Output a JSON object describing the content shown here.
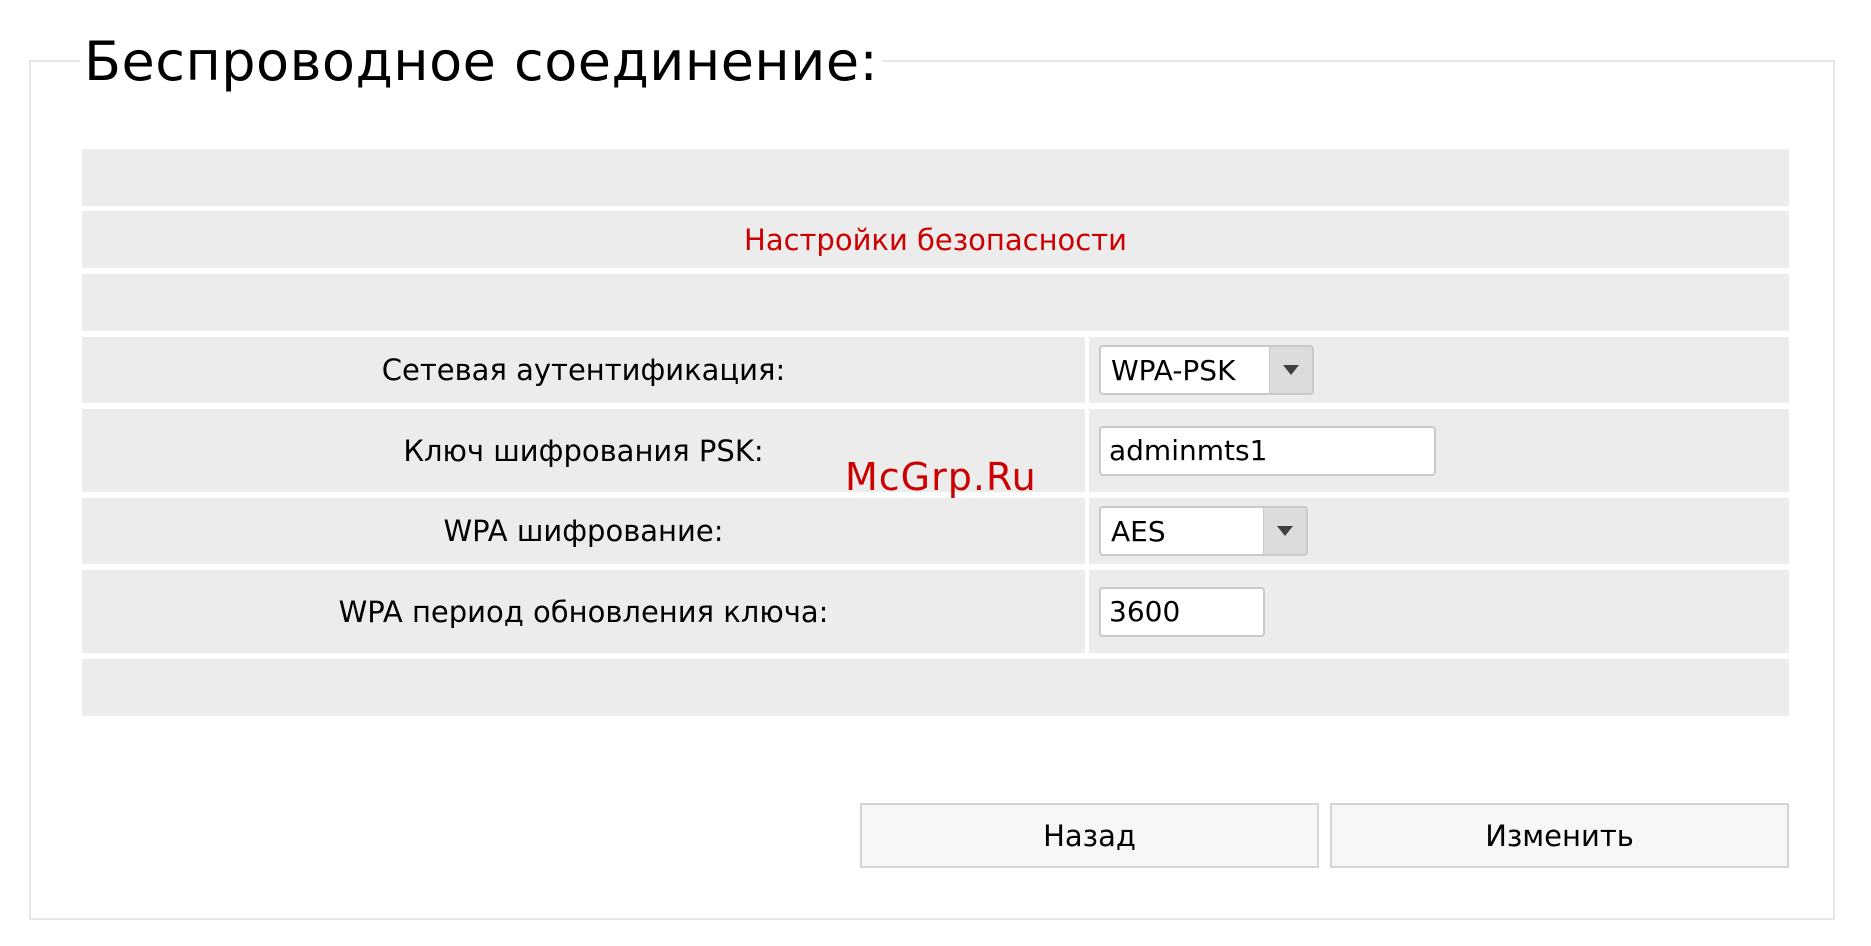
{
  "page": {
    "legend_title": "Беспроводное соединение:",
    "section_title": "Настройки безопасности"
  },
  "fields": {
    "auth_label": "Сетевая аутентификация:",
    "auth_value": "WPA-PSK",
    "psk_label": "Ключ шифрования PSK:",
    "psk_value": "adminmts1",
    "wpa_enc_label": "WPA шифрование:",
    "wpa_enc_value": "AES",
    "rekey_label": "WPA период обновления ключа:",
    "rekey_value": "3600"
  },
  "buttons": {
    "back": "Назад",
    "apply": "Изменить"
  },
  "watermark": "McGrp.Ru",
  "colors": {
    "section_title": "#cc0000",
    "band": "#ececec"
  },
  "icons": {
    "dropdown": "chevron-down-icon"
  }
}
